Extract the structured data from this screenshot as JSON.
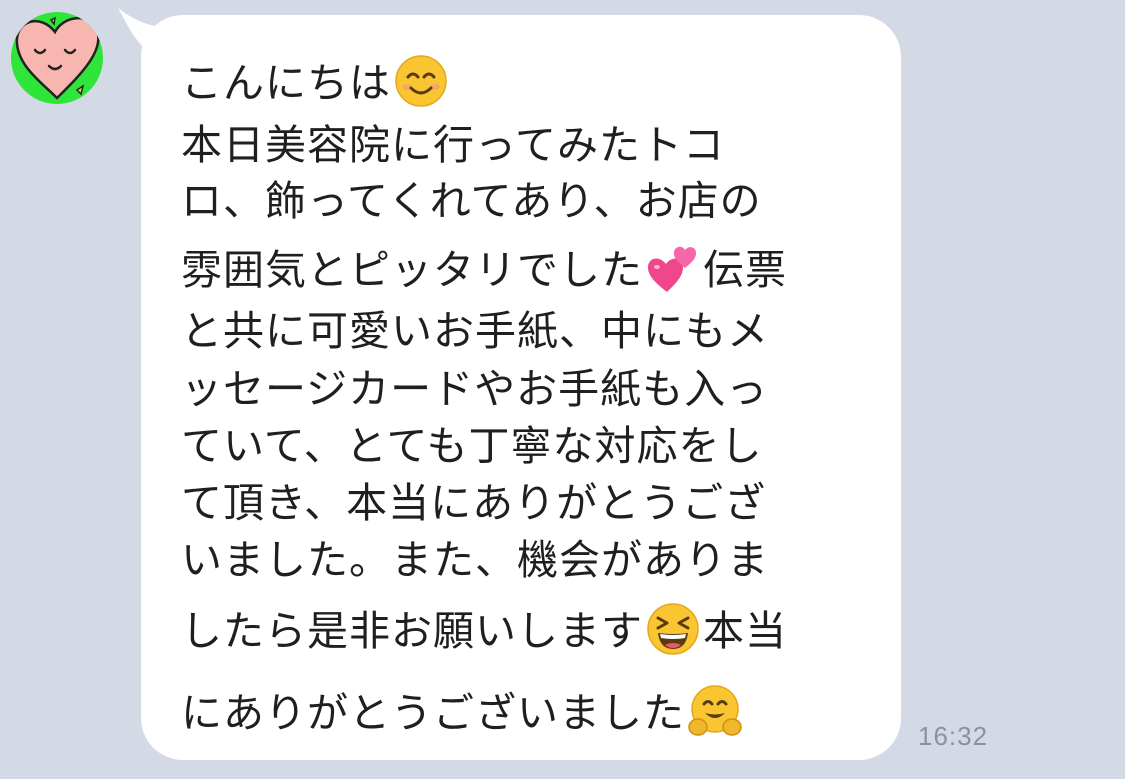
{
  "contact": {
    "avatar_icon": "heart-face-icon",
    "avatar_bg": "#2fe53a",
    "heart_color": "#f7b6b0"
  },
  "message": {
    "line1": "こんにちは",
    "line2": "本日美容院に行ってみたトコ",
    "line3": "ロ、飾ってくれてあり、お店の",
    "line4a": "雰囲気とピッタリでした",
    "line4b": "伝票",
    "line5": "と共に可愛いお手紙、中にもメ",
    "line6": "ッセージカードやお手紙も入っ",
    "line7": "ていて、とても丁寧な対応をし",
    "line8": "て頂き、本当にありがとうござ",
    "line9": "いました。また、機会がありま",
    "line10a": "したら是非お願いします",
    "line10b": "本当",
    "line11": "にありがとうございました",
    "emojis": [
      "smiling-face-icon",
      "two-hearts-icon",
      "grinning-squinting-face-icon",
      "hugging-face-icon"
    ]
  },
  "timestamp": "16:32",
  "colors": {
    "background": "#d3dae6",
    "bubble": "#ffffff",
    "text": "#1f1f1f",
    "timestamp": "#8a92a0"
  }
}
